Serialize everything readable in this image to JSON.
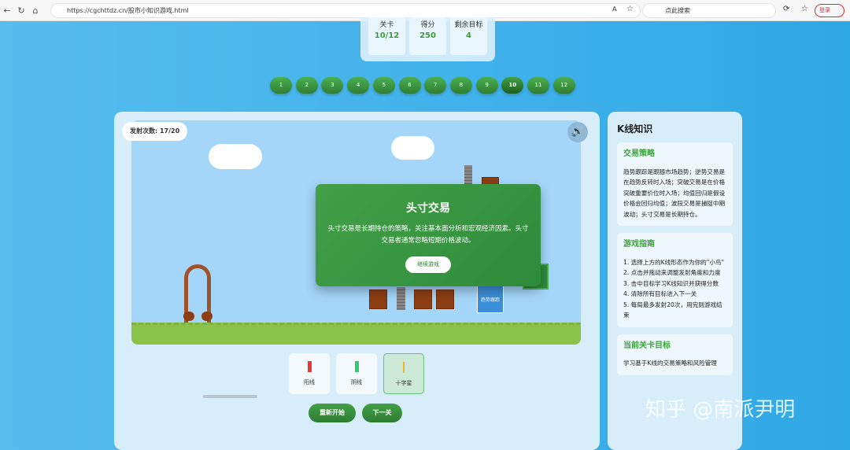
{
  "browser": {
    "url": "https://cgchttdz.cn/股市小知识游戏.html",
    "search_placeholder": "点此搜索",
    "login": "登录"
  },
  "stats": [
    {
      "label": "关卡",
      "value": "10/12"
    },
    {
      "label": "得分",
      "value": "250"
    },
    {
      "label": "剩余目标",
      "value": "4"
    }
  ],
  "levels": [
    "1",
    "2",
    "3",
    "4",
    "5",
    "6",
    "7",
    "8",
    "9",
    "10",
    "11",
    "12"
  ],
  "current_level": 10,
  "game": {
    "shots": "发射次数: 17/20",
    "target_label": "趋势跟踪"
  },
  "modal": {
    "title": "头寸交易",
    "text": "头寸交易是长期持仓的策略，关注基本面分析和宏观经济因素。头寸交易者通常忽略短期价格波动。",
    "button": "继续游戏"
  },
  "candles": [
    {
      "label": "阳线",
      "color": "#e53935"
    },
    {
      "label": "阴线",
      "color": "#2ecc71"
    },
    {
      "label": "十字星",
      "color": "#f0b429"
    }
  ],
  "buttons": {
    "restart": "重新开始",
    "next": "下一关"
  },
  "sidebar": {
    "title": "K线知识",
    "strategy": {
      "title": "交易策略",
      "text": "趋势跟踪是跟随市场趋势；逆势交易是在趋势反转时入场；突破交易是在价格突破重要价位时入场；均值回归是假设价格会回归均值；波段交易是捕捉中期波动；头寸交易是长期持仓。"
    },
    "guide": {
      "title": "游戏指南",
      "items": [
        "1. 选择上方的K线形态作为你的\"小鸟\"",
        "2. 点击并拖动来调整发射角度和力度",
        "3. 击中目标学习K线知识并获得分数",
        "4. 清除所有目标进入下一关",
        "5. 每局最多发射20次，用完则游戏结束"
      ]
    },
    "current": {
      "title": "当前关卡目标",
      "text": "学习基于K线的交易策略和风险管理"
    }
  },
  "watermark": "知乎 @南派尹明"
}
